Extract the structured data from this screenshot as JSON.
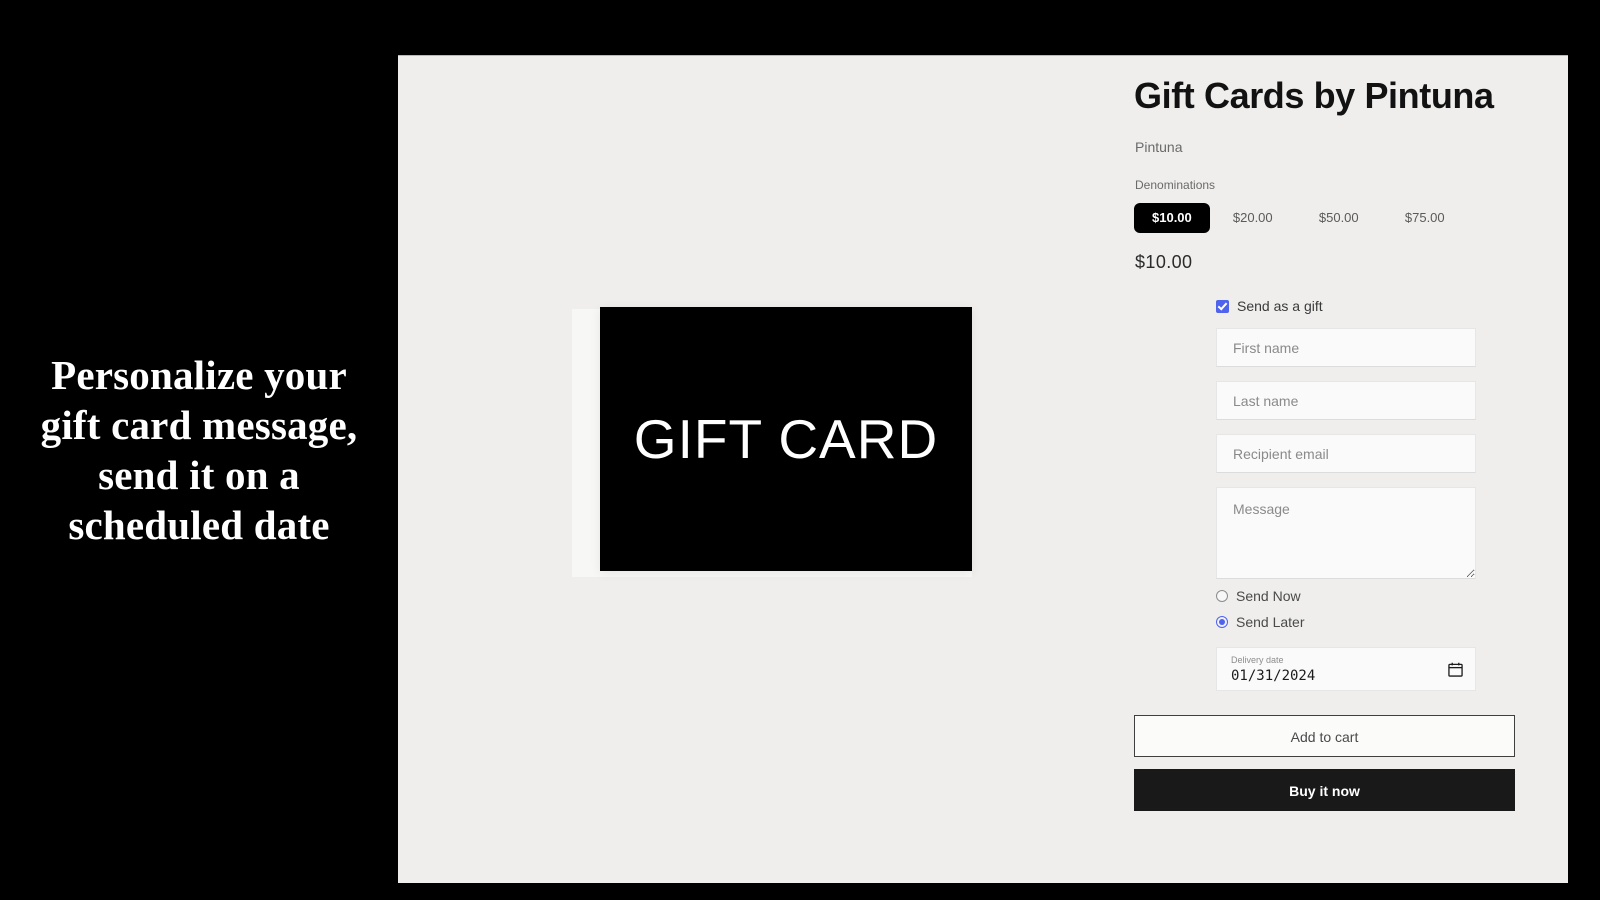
{
  "promo": {
    "heading": "Personalize your gift card message, send it on a scheduled date"
  },
  "media": {
    "card_label": "GIFT CARD"
  },
  "product": {
    "title": "Gift Cards by Pintuna",
    "vendor": "Pintuna",
    "denominations_label": "Denominations",
    "denominations": [
      "$10.00",
      "$20.00",
      "$50.00",
      "$75.00"
    ],
    "selected_denomination": "$10.00",
    "price": "$10.00"
  },
  "gift_form": {
    "send_as_gift_label": "Send as a gift",
    "send_as_gift_checked": true,
    "first_name_placeholder": "First name",
    "first_name_value": "",
    "last_name_placeholder": "Last name",
    "last_name_value": "",
    "recipient_email_placeholder": "Recipient email",
    "recipient_email_value": "",
    "message_placeholder": "Message",
    "message_value": "",
    "send_now_label": "Send Now",
    "send_later_label": "Send Later",
    "selected_timing": "Send Later",
    "delivery_date_caption": "Delivery date",
    "delivery_date_value": "01/31/2024",
    "calendar_icon": "calendar-icon"
  },
  "actions": {
    "add_to_cart_label": "Add to cart",
    "buy_now_label": "Buy it now"
  },
  "colors": {
    "page_background": "#000000",
    "panel_background": "#efeeec",
    "accent": "#4f63ec",
    "primary_button": "#191919",
    "text": "#121212"
  }
}
